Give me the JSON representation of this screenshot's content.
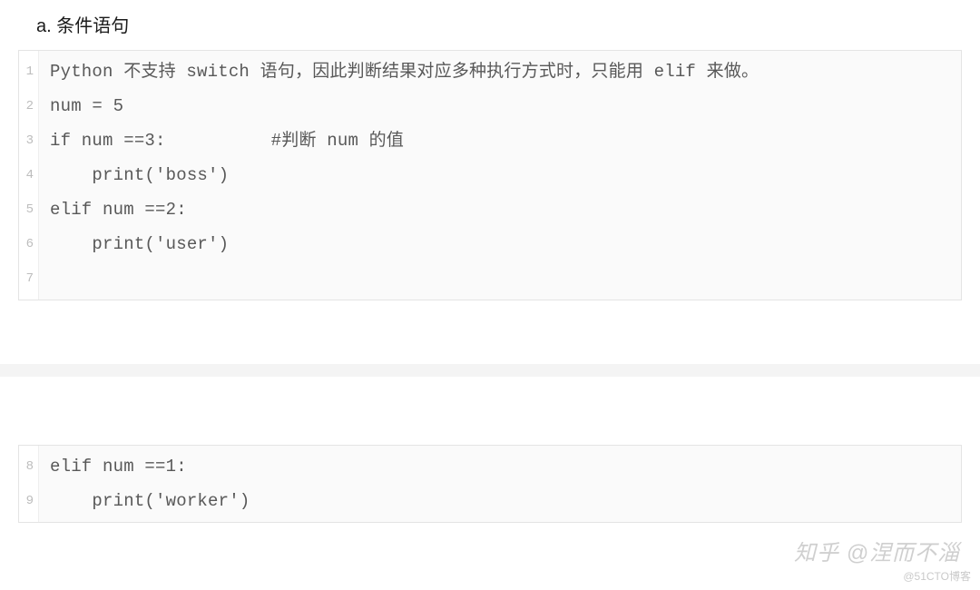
{
  "heading": "a. 条件语句",
  "block1": {
    "lines": [
      "Python 不支持 switch 语句，因此判断结果对应多种执行方式时，只能用 elif 来做。",
      "",
      "num = 5",
      "if num ==3:          #判断 num 的值",
      "    print('boss')",
      "elif num ==2:",
      "    print('user')"
    ],
    "lineNumbers": [
      "1",
      "2",
      "3",
      "4",
      "5",
      "6",
      "7"
    ]
  },
  "block2": {
    "lines": [
      "elif num ==1:",
      "    print('worker')"
    ],
    "lineNumbers": [
      "8",
      "9"
    ]
  },
  "watermark1": "知乎 @涅而不淄",
  "watermark2": "@51CTO博客"
}
